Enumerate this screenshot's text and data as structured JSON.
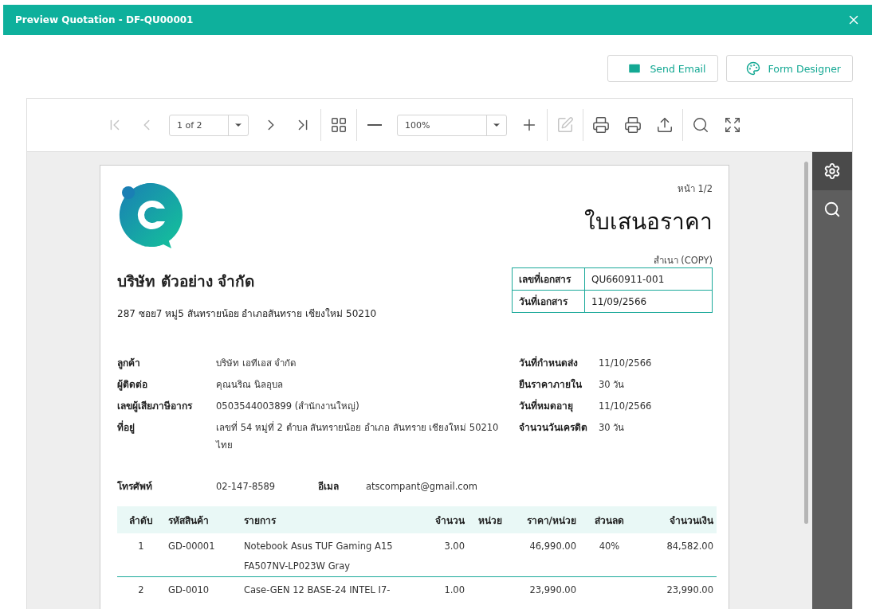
{
  "window": {
    "title": "Preview Quotation - DF-QU00001"
  },
  "actions": [
    {
      "label": "Send Email",
      "kind": "email"
    },
    {
      "label": "Form Designer",
      "kind": "designer"
    }
  ],
  "toolbar": {
    "items": [
      {
        "kind": "button",
        "disabled": true
      },
      {
        "kind": "button",
        "disabled": true
      },
      {
        "kind": "select",
        "value": "1 of 2"
      },
      {
        "kind": "button",
        "disabled": false
      },
      {
        "kind": "button",
        "disabled": false
      },
      {
        "kind": "separator"
      },
      {
        "kind": "button",
        "disabled": false
      },
      {
        "kind": "separator"
      },
      {
        "kind": "button",
        "disabled": false
      },
      {
        "kind": "select",
        "value": "100%"
      },
      {
        "kind": "button",
        "disabled": false
      },
      {
        "kind": "separator"
      },
      {
        "kind": "button",
        "disabled": true
      },
      {
        "kind": "separator"
      },
      {
        "kind": "button",
        "disabled": false
      },
      {
        "kind": "button",
        "disabled": false
      },
      {
        "kind": "button",
        "disabled": false
      },
      {
        "kind": "separator"
      },
      {
        "kind": "button",
        "disabled": false
      },
      {
        "kind": "button",
        "disabled": false
      }
    ]
  },
  "side_panel": {
    "items": [
      {
        "kind": "settings",
        "selected": true
      },
      {
        "kind": "search",
        "selected": false
      }
    ]
  },
  "document": {
    "page_label": "หน้า 1/2",
    "title": "ใบเสนอราคา",
    "copy_label": "สำเนา (COPY)",
    "company_name": "บริษัท ตัวอย่าง จำกัด",
    "company_address": "287 ซอย7 หมู่5 สันทรายน้อย อำเภอสันทราย เชียงใหม่ 50210",
    "doc_info": [
      {
        "label": "เลขที่เอกสาร",
        "value": "QU660911-001"
      },
      {
        "label": "วันที่เอกสาร",
        "value": "11/09/2566"
      }
    ],
    "customer_fields": [
      {
        "label": "ลูกค้า",
        "lines": [
          "บริษัท เอทีเอส จำกัด"
        ]
      },
      {
        "label": "ผู้ติดต่อ",
        "lines": [
          "คุณนริณ นิลอุบล"
        ]
      },
      {
        "label": "เลขผู้เสียภาษีอากร",
        "lines": [
          "0503544003899 (สำนักงานใหญ่)"
        ]
      },
      {
        "label": "ที่อยู่",
        "lines": [
          "เลขที่ 54 หมู่ที่ 2  ตำบล สันทรายน้อย อำเภอ สันทราย เชียงใหม่ 50210",
          "ไทย"
        ]
      }
    ],
    "terms_fields": [
      {
        "label": "วันที่กำหนดส่ง",
        "value": "11/10/2566"
      },
      {
        "label": "ยืนราคาภายใน",
        "value": "30 วัน"
      },
      {
        "label": "วันที่หมดอายุ",
        "value": "11/10/2566"
      },
      {
        "label": "จำนวนวันเครดิต",
        "value": "30 วัน"
      }
    ],
    "contact": {
      "phone_label": "โทรศัพท์",
      "phone": "02-147-8589",
      "email_label": "อีเมล",
      "email": "atscompant@gmail.com"
    },
    "table": {
      "columns": [
        {
          "label": "ลำดับ"
        },
        {
          "label": "รหัสสินค้า"
        },
        {
          "label": "รายการ"
        },
        {
          "label": "จำนวน"
        },
        {
          "label": "หน่วย"
        },
        {
          "label": "ราคา/หน่วย"
        },
        {
          "label": "ส่วนลด"
        },
        {
          "label": "จำนวนเงิน"
        }
      ],
      "rows": [
        {
          "cells": [
            "1",
            "GD-00001",
            "Notebook Asus TUF Gaming A15 FA507NV-LP023W Gray",
            "3.00",
            "",
            "46,990.00",
            "40%",
            "84,582.00"
          ]
        },
        {
          "cells": [
            "2",
            "GD-0010",
            "Case-GEN 12 BASE-24 INTEL I7-",
            "1.00",
            "",
            "23,990.00",
            "",
            "23,990.00"
          ]
        }
      ]
    }
  }
}
